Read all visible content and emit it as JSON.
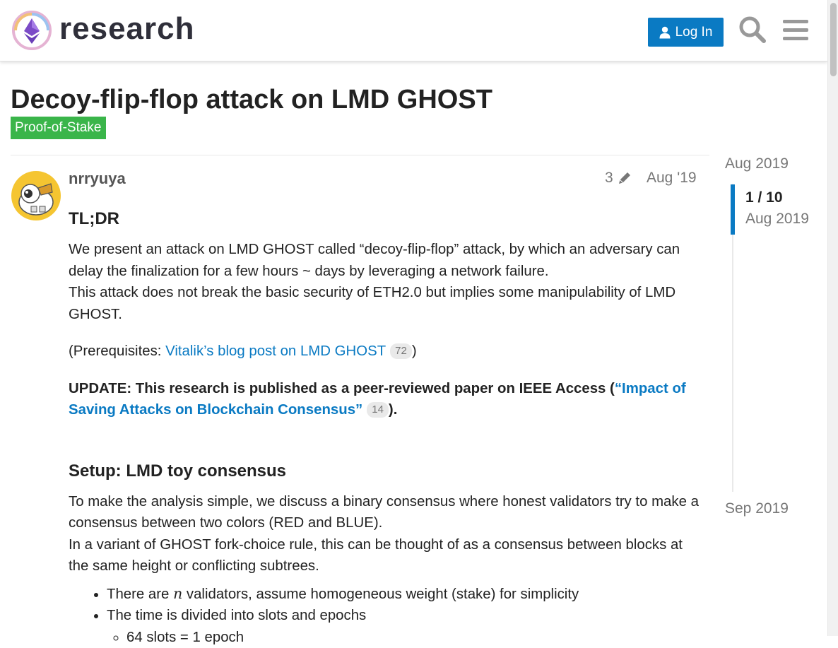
{
  "header": {
    "logo_text": "research",
    "login_label": "Log In"
  },
  "topic": {
    "title": "Decoy-flip-flop attack on LMD GHOST",
    "category": "Proof-of-Stake",
    "category_color": "#3ab54a"
  },
  "post": {
    "username": "nrryuya",
    "edit_count": "3",
    "date": "Aug '19",
    "tldr_heading": "TL;DR",
    "intro_line1": "We present an attack on LMD GHOST called “decoy-flip-flop” attack, by which an adversary can delay the finalization for a few hours ~ days by leveraging a network failure.",
    "intro_line2": "This attack does not break the basic security of ETH2.0 but implies some manipulability of LMD GHOST.",
    "prereq_prefix": "(Prerequisites: ",
    "prereq_link": "Vitalik’s blog post on LMD GHOST",
    "prereq_clicks": "72",
    "prereq_suffix": ")",
    "update_prefix": "UPDATE: This research is published as a peer-reviewed paper on IEEE Access (",
    "update_link": "“Impact of Saving Attacks on Blockchain Consensus”",
    "update_clicks": "14",
    "update_suffix": ").",
    "setup_heading": "Setup: LMD toy consensus",
    "setup_line1": "To make the analysis simple, we discuss a binary consensus where honest validators try to make a consensus between two colors (RED and BLUE).",
    "setup_line2": "In a variant of GHOST fork-choice rule, this can be thought of as a consensus between blocks at the same height or conflicting subtrees.",
    "bullet1_prefix": "There are ",
    "bullet1_math": "n",
    "bullet1_suffix": " validators, assume homogeneous weight (stake) for simplicity",
    "bullet2": "The time is divided into slots and epochs",
    "subbullet1": "64 slots = 1 epoch"
  },
  "timeline": {
    "start_label": "Aug 2019",
    "position": "1 / 10",
    "position_date": "Aug 2019",
    "end_label": "Sep 2019"
  },
  "colors": {
    "accent": "#0a7ac3",
    "category": "#3ab54a"
  },
  "icons": [
    "logo-mark-icon",
    "user-icon",
    "search-icon",
    "hamburger-menu-icon",
    "pencil-icon"
  ]
}
